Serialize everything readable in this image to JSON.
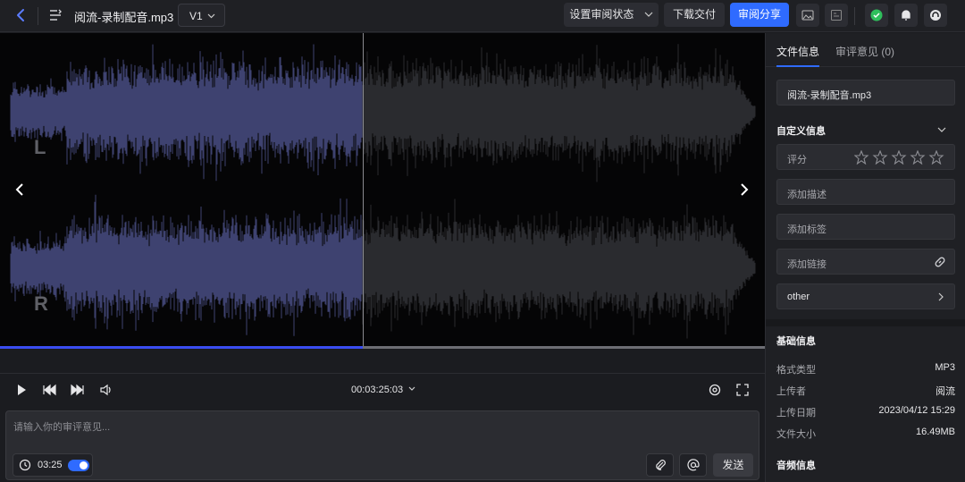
{
  "topbar": {
    "title": "阅流-录制配音.mp3",
    "version": "V1",
    "set_status_label": "设置审阅状态",
    "download_label": "下载交付",
    "share_label": "审阅分享"
  },
  "player": {
    "left_channel": "L",
    "right_channel": "R",
    "timecode": "00:03:25:03",
    "progress_fraction": 0.474
  },
  "comment": {
    "placeholder": "请输入你的审评意见...",
    "time": "03:25",
    "send_label": "发送"
  },
  "panel": {
    "tabs": [
      {
        "label": "文件信息"
      },
      {
        "label": "审评意见 (0)"
      }
    ],
    "file_name": "阅流-录制配音.mp3",
    "custom_info_label": "自定义信息",
    "rating_label": "评分",
    "rating_value": 0,
    "add_description": "添加描述",
    "add_tags": "添加标签",
    "add_link": "添加链接",
    "other_label": "other",
    "basic_info_label": "基础信息",
    "basic_info": [
      {
        "key": "格式类型",
        "value": "MP3"
      },
      {
        "key": "上传者",
        "value": "阅流"
      },
      {
        "key": "上传日期",
        "value": "2023/04/12 15:29"
      },
      {
        "key": "文件大小",
        "value": "16.49MB"
      }
    ],
    "audio_info_label": "音频信息"
  },
  "colors": {
    "accent": "#2f6bff",
    "wave_played": "#3e4270",
    "wave_unplayed": "#2a2b2f",
    "background": "#1b1c20"
  }
}
